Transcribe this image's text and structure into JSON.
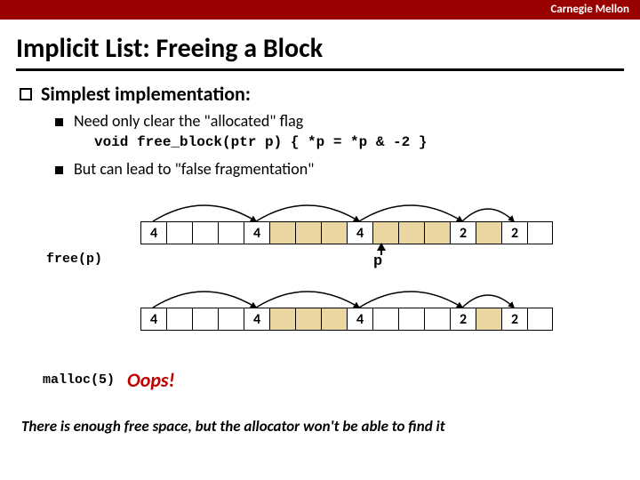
{
  "brand": "Carnegie Mellon",
  "title": "Implicit List: Freeing a Block",
  "bullet_main": "Simplest implementation:",
  "sub1": "Need only clear the \"allocated\" flag",
  "code": "void free_block(ptr p) { *p = *p & -2 }",
  "sub2": "But can lead to \"false fragmentation\"",
  "diagram1": {
    "left_label": "free(p)",
    "p_label": "p",
    "cells": [
      "4",
      "",
      "",
      "",
      "4",
      "",
      "",
      "",
      "4",
      "",
      "",
      "",
      "2",
      "",
      "2",
      ""
    ]
  },
  "diagram2": {
    "cells": [
      "4",
      "",
      "",
      "",
      "4",
      "",
      "",
      "",
      "4",
      "",
      "",
      "",
      "2",
      "",
      "2",
      ""
    ]
  },
  "malloc_label": "malloc(5)",
  "oops": "Oops!",
  "closing": "There is enough free space, but the allocator won't be able to find it"
}
